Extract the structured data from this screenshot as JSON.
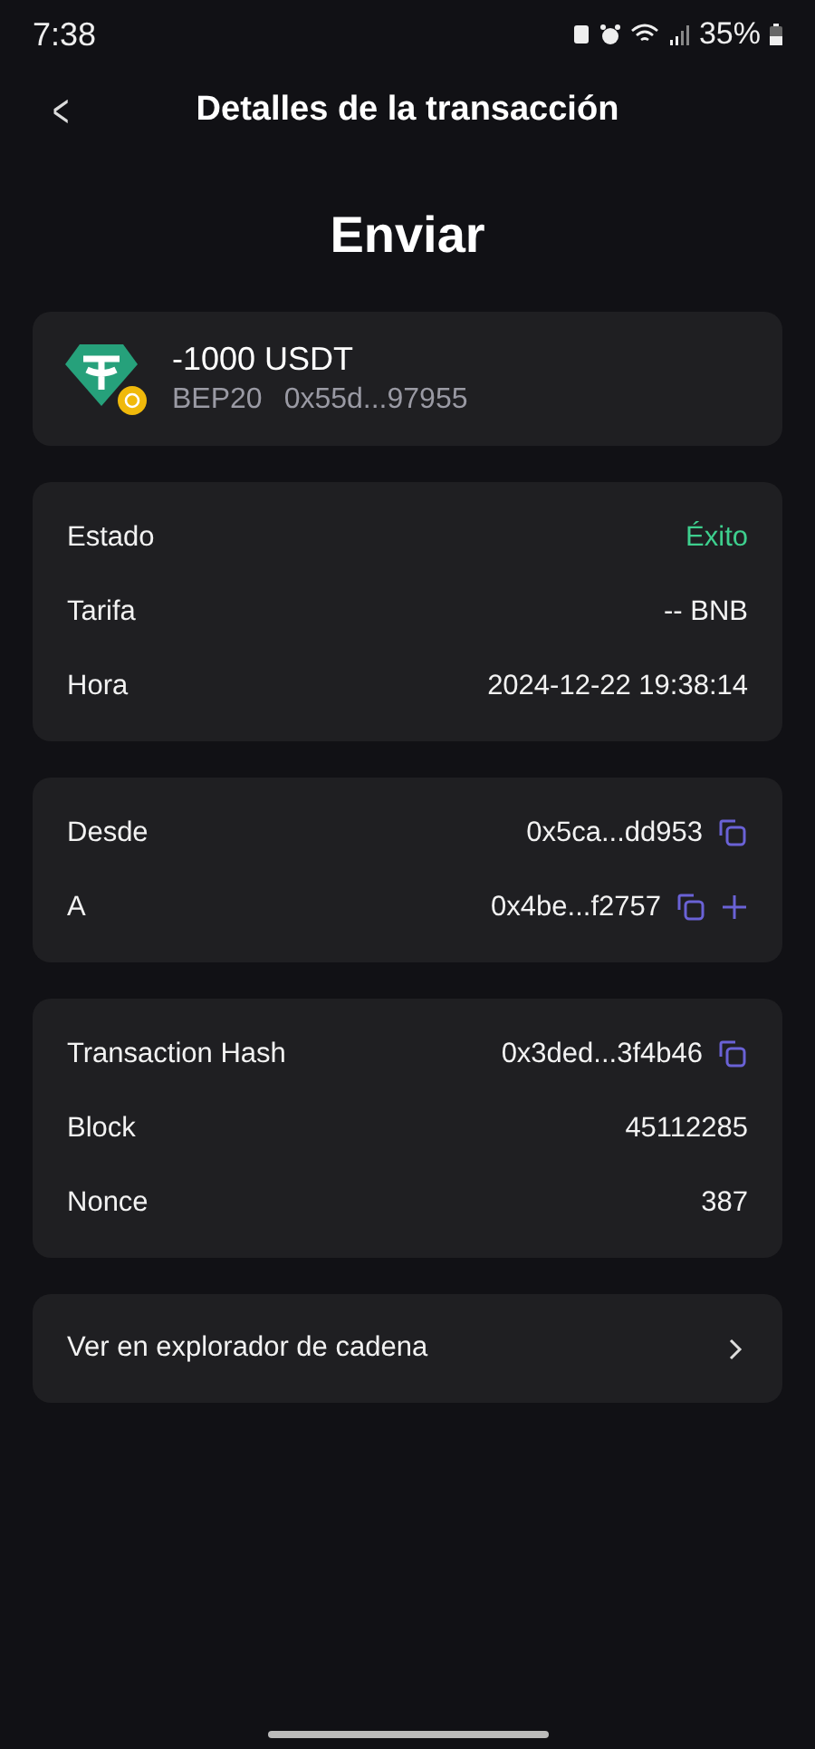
{
  "status_bar": {
    "time": "7:38",
    "battery": "35%"
  },
  "header": {
    "back": "<",
    "title": "Detalles de la transacción"
  },
  "type_title": "Enviar",
  "asset": {
    "amount": "-1000 USDT",
    "network": "BEP20",
    "contract": "0x55d...97955"
  },
  "sections": [
    {
      "rows": [
        {
          "label": "Estado",
          "value": "Éxito",
          "kind": "status",
          "copy": false,
          "add": false
        },
        {
          "label": "Tarifa",
          "value": "-- BNB",
          "kind": "text",
          "copy": false,
          "add": false
        },
        {
          "label": "Hora",
          "value": "2024-12-22 19:38:14",
          "kind": "text",
          "copy": false,
          "add": false
        }
      ]
    },
    {
      "rows": [
        {
          "label": "Desde",
          "value": "0x5ca...dd953",
          "kind": "text",
          "copy": true,
          "add": false
        },
        {
          "label": "A",
          "value": "0x4be...f2757",
          "kind": "text",
          "copy": true,
          "add": true
        }
      ]
    },
    {
      "rows": [
        {
          "label": "Transaction Hash",
          "value": "0x3ded...3f4b46",
          "kind": "text",
          "copy": true,
          "add": false
        },
        {
          "label": "Block",
          "value": "45112285",
          "kind": "text",
          "copy": false,
          "add": false
        },
        {
          "label": "Nonce",
          "value": "387",
          "kind": "text",
          "copy": false,
          "add": false
        }
      ]
    }
  ],
  "explorer_link": "Ver en explorador de cadena"
}
